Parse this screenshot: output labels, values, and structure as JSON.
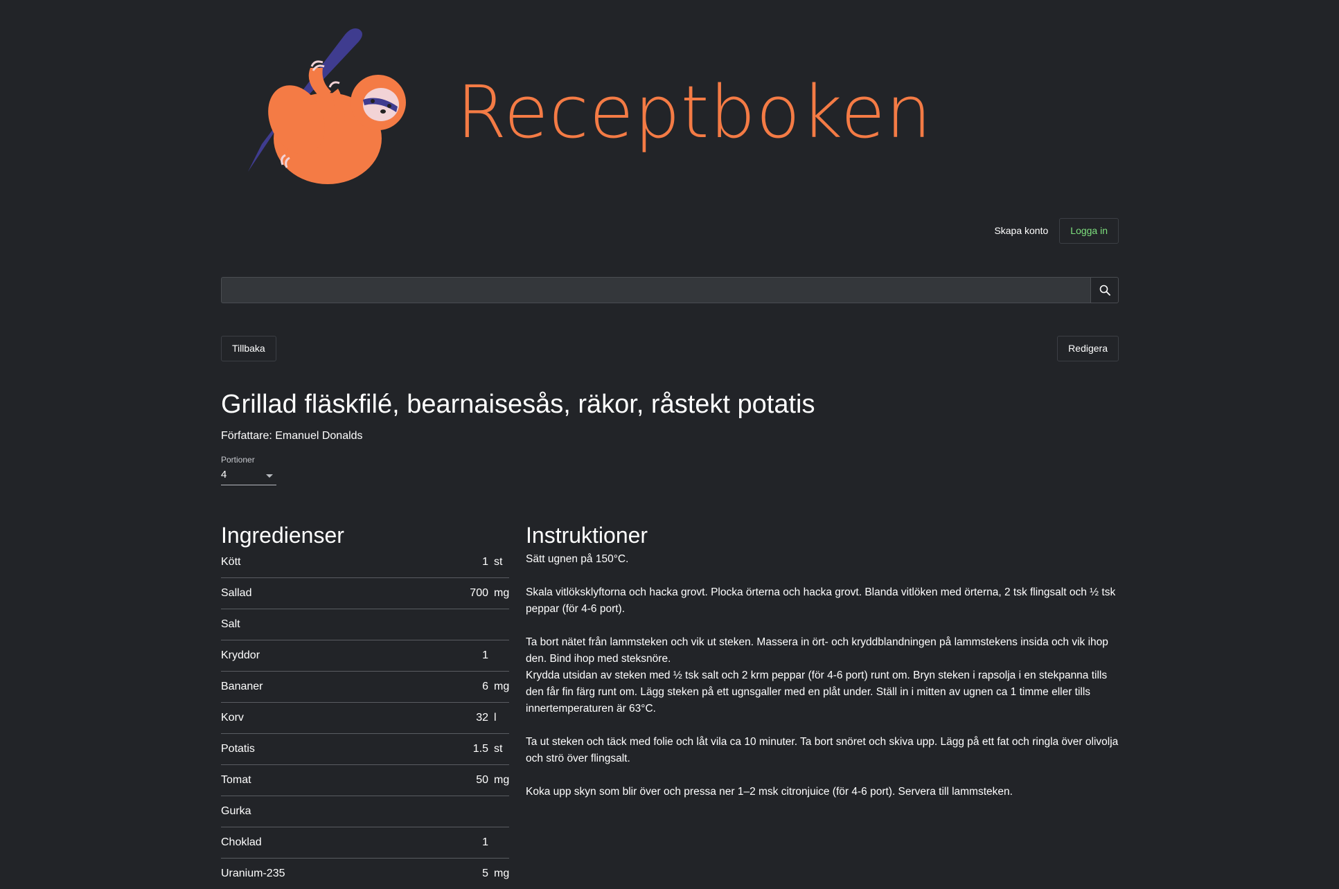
{
  "header": {
    "brand": "Receptboken",
    "logo_icon": "sloth-logo-icon",
    "signup_label": "Skapa konto",
    "login_label": "Logga in"
  },
  "search": {
    "value": "",
    "icon": "search-icon"
  },
  "actions": {
    "back_label": "Tillbaka",
    "edit_label": "Redigera"
  },
  "recipe": {
    "title": "Grillad fläskfilé, bearnaisesås, räkor, råstekt potatis",
    "author": "Författare: Emanuel Donalds",
    "portions_label": "Portioner",
    "portions_value": "4"
  },
  "ingredients": {
    "heading": "Ingredienser",
    "items": [
      {
        "name": "Kött",
        "qty": "1",
        "unit": "st"
      },
      {
        "name": "Sallad",
        "qty": "700",
        "unit": "mg"
      },
      {
        "name": "Salt",
        "qty": "",
        "unit": ""
      },
      {
        "name": "Kryddor",
        "qty": "1",
        "unit": ""
      },
      {
        "name": "Bananer",
        "qty": "6",
        "unit": "mg"
      },
      {
        "name": "Korv",
        "qty": "32",
        "unit": "l"
      },
      {
        "name": "Potatis",
        "qty": "1.5",
        "unit": "st"
      },
      {
        "name": "Tomat",
        "qty": "50",
        "unit": "mg"
      },
      {
        "name": "Gurka",
        "qty": "",
        "unit": ""
      },
      {
        "name": "Choklad",
        "qty": "1",
        "unit": ""
      },
      {
        "name": "Uranium-235",
        "qty": "5",
        "unit": "mg"
      }
    ]
  },
  "instructions": {
    "heading": "Instruktioner",
    "lines": [
      "Sätt ugnen på 150°C.",
      "",
      "Skala vitlöksklyftorna och hacka grovt. Plocka örterna och hacka grovt. Blanda vitlöken med örterna, 2 tsk flingsalt och ½ tsk peppar (för 4-6 port).",
      "",
      "Ta bort nätet från lammsteken och vik ut steken. Massera in ört- och kryddblandningen på lammstekens insida och vik ihop den. Bind ihop med steksnöre.",
      "Krydda utsidan av steken med ½ tsk salt och 2 krm peppar (för 4-6 port) runt om. Bryn steken i rapsolja i en stekpanna tills den får fin färg runt om. Lägg steken på ett ugnsgaller med en plåt under. Ställ in i mitten av ugnen ca 1 timme eller tills innertemperaturen är 63°C.",
      "",
      "Ta ut steken och täck med folie och låt vila ca 10 minuter. Ta bort snöret och skiva upp. Lägg på ett fat och ringla över olivolja och strö över flingsalt.",
      "",
      "Koka upp skyn som blir över och pressa ner 1–2 msk citronjuice (för 4-6 port). Servera till lammsteken."
    ]
  },
  "colors": {
    "background": "#222428",
    "brand": "#f47b45",
    "branch": "#3f3c8f",
    "login": "#7ee07e"
  }
}
